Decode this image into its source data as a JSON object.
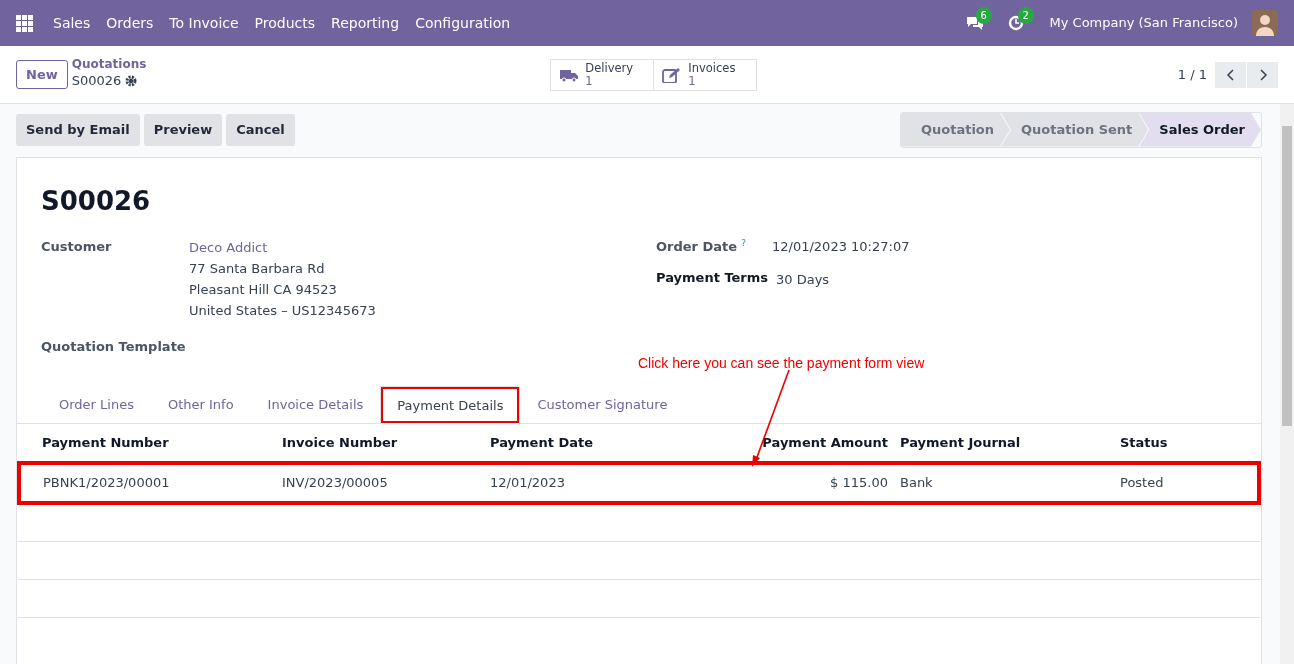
{
  "navbar": {
    "app": "Sales",
    "menus": [
      "Orders",
      "To Invoice",
      "Products",
      "Reporting",
      "Configuration"
    ],
    "messages_count": "6",
    "activities_count": "2",
    "company": "My Company (San Francisco)"
  },
  "control_panel": {
    "new_button": "New",
    "breadcrumb_parent": "Quotations",
    "breadcrumb_current": "S00026",
    "smart_buttons": [
      {
        "kind": "truck",
        "label": "Delivery",
        "value": "1"
      },
      {
        "kind": "edit",
        "label": "Invoices",
        "value": "1"
      }
    ],
    "pager": "1 / 1"
  },
  "actions": [
    "Send by Email",
    "Preview",
    "Cancel"
  ],
  "statusbar": [
    {
      "label": "Quotation",
      "selected": false
    },
    {
      "label": "Quotation Sent",
      "selected": false
    },
    {
      "label": "Sales Order",
      "selected": true
    }
  ],
  "form": {
    "title": "S00026",
    "customer_label": "Customer",
    "customer_name": "Deco Addict",
    "customer_address": [
      "77 Santa Barbara Rd",
      "Pleasant Hill CA 94523",
      "United States – US12345673"
    ],
    "template_label": "Quotation Template",
    "order_date_label": "Order Date",
    "order_date_help": "?",
    "order_date": "12/01/2023 10:27:07",
    "payment_terms_label": "Payment Terms",
    "payment_terms": "30 Days"
  },
  "tabs": [
    {
      "label": "Order Lines",
      "selected": false,
      "highlighted": false
    },
    {
      "label": "Other Info",
      "selected": false,
      "highlighted": false
    },
    {
      "label": "Invoice Details",
      "selected": false,
      "highlighted": false
    },
    {
      "label": "Payment Details",
      "selected": true,
      "highlighted": true
    },
    {
      "label": "Customer Signature",
      "selected": false,
      "highlighted": false
    }
  ],
  "table": {
    "columns": [
      {
        "label": "Payment Number",
        "numeric": false
      },
      {
        "label": "Invoice Number",
        "numeric": false
      },
      {
        "label": "Payment Date",
        "numeric": false
      },
      {
        "label": "Payment Amount",
        "numeric": true
      },
      {
        "label": "Payment Journal",
        "numeric": false
      },
      {
        "label": "Status",
        "numeric": false
      }
    ],
    "rows": [
      {
        "highlighted": true,
        "cells": [
          "PBNK1/2023/00001",
          "INV/2023/00005",
          "12/01/2023",
          "$ 115.00",
          "Bank",
          "Posted"
        ]
      }
    ]
  },
  "annotation": {
    "text": "Click here you can see the payment form view"
  }
}
